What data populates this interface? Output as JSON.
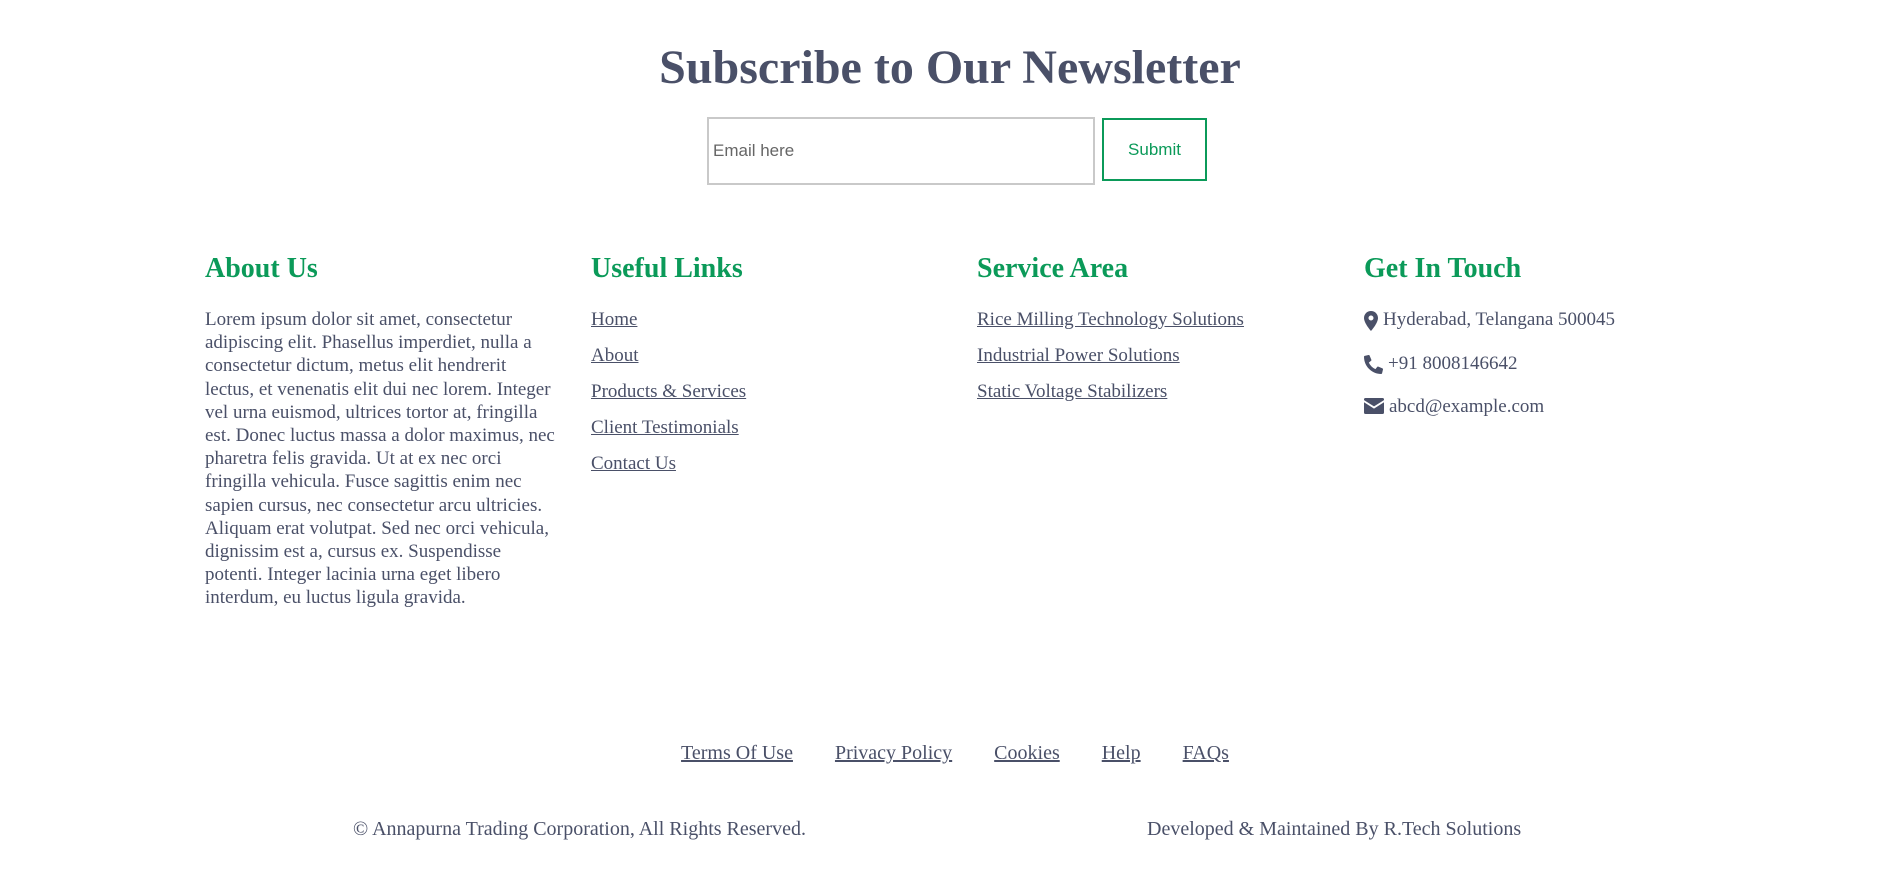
{
  "newsletter": {
    "title": "Subscribe to Our Newsletter",
    "email_placeholder": "Email here",
    "email_value": "",
    "submit_label": "Submit"
  },
  "about": {
    "heading": "About Us",
    "text": "Lorem ipsum dolor sit amet, consectetur adipiscing elit. Phasellus imperdiet, nulla a consectetur dictum, metus elit hendrerit lectus, et venenatis elit dui nec lorem. Integer vel urna euismod, ultrices tortor at, fringilla est. Donec luctus massa a dolor maximus, nec pharetra felis gravida. Ut at ex nec orci fringilla vehicula. Fusce sagittis enim nec sapien cursus, nec consectetur arcu ultricies. Aliquam erat volutpat. Sed nec orci vehicula, dignissim est a, cursus ex. Suspendisse potenti. Integer lacinia urna eget libero interdum, eu luctus ligula gravida."
  },
  "useful_links": {
    "heading": "Useful Links",
    "items": [
      {
        "label": "Home"
      },
      {
        "label": "About"
      },
      {
        "label": "Products & Services"
      },
      {
        "label": "Client Testimonials"
      },
      {
        "label": "Contact Us"
      }
    ]
  },
  "service_area": {
    "heading": "Service Area",
    "items": [
      {
        "label": "Rice Milling Technology Solutions"
      },
      {
        "label": "Industrial Power Solutions"
      },
      {
        "label": "Static Voltage Stabilizers"
      }
    ]
  },
  "contact": {
    "heading": "Get In Touch",
    "address": "Hyderabad, Telangana 500045",
    "phone": "+91 8008146642",
    "email": "abcd@example.com",
    "icons": [
      "map-marker-icon",
      "phone-icon",
      "envelope-icon"
    ]
  },
  "footer": {
    "links": [
      {
        "label": "Terms Of Use"
      },
      {
        "label": "Privacy Policy"
      },
      {
        "label": "Cookies"
      },
      {
        "label": "Help"
      },
      {
        "label": "FAQs"
      }
    ],
    "copyright": "© Annapurna Trading Corporation, All Rights Reserved.",
    "developer": "Developed & Maintained By R.Tech Solutions"
  },
  "colors": {
    "accent": "#0b9a59",
    "text": "#4a5068",
    "input_border": "#c9c9c9"
  }
}
